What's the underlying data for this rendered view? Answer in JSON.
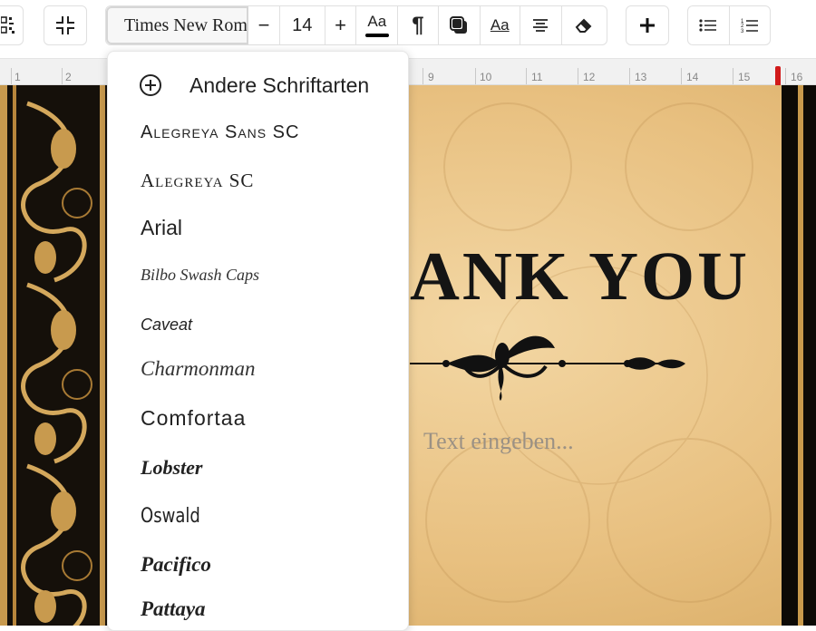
{
  "toolbar": {
    "font_name": "Times New Roman",
    "size_value": "14",
    "size_decrease": "−",
    "size_increase": "+",
    "text_style_glyph": "Aa",
    "paragraph_glyph": "¶",
    "font_case_glyph": "Aa",
    "icons": [
      "qr-code-icon",
      "collapse-icon",
      "text-color-icon",
      "paragraph-icon",
      "shadow-icon",
      "font-case-icon",
      "align-center-icon",
      "eraser-icon",
      "add-icon",
      "bullet-list-icon",
      "numbered-list-icon"
    ],
    "accent_color": "#000000"
  },
  "ruler": {
    "numbers": [
      "1",
      "2",
      "9",
      "10",
      "11",
      "12",
      "13",
      "14",
      "15",
      "16"
    ],
    "marker_color": "#d11a1a"
  },
  "font_menu": {
    "other_fonts_label": "Andere Schriftarten",
    "fonts": [
      "Alegreya Sans SC",
      "Alegreya SC",
      "Arial",
      "Bilbo Swash Caps",
      "Caveat",
      "Charmonman",
      "Comfortaa",
      "Lobster",
      "Oswald",
      "Pacifico",
      "Pattaya"
    ]
  },
  "card": {
    "heading": "ANK YOU",
    "placeholder": "Text eingeben..."
  }
}
